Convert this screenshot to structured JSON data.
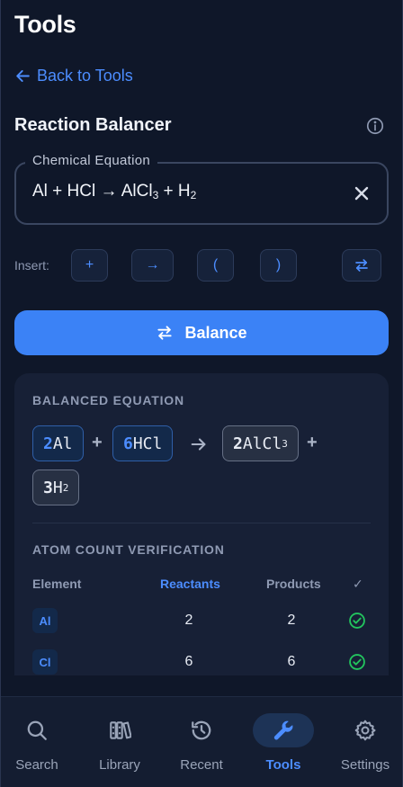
{
  "header": {
    "title": "Tools",
    "back_label": "Back to Tools"
  },
  "section": {
    "title": "Reaction Balancer"
  },
  "input": {
    "label": "Chemical Equation",
    "value_parts": [
      "Al + HCl → AlCl",
      "3",
      " + H",
      "2"
    ]
  },
  "insert": {
    "label": "Insert:",
    "buttons": [
      "+",
      "→",
      "(",
      ")"
    ]
  },
  "balance_button": {
    "label": "Balance"
  },
  "result": {
    "heading": "BALANCED EQUATION",
    "terms": [
      {
        "coef": "2",
        "formula": "Al",
        "sub": "",
        "side": "reactant"
      },
      {
        "coef": "6",
        "formula": "HCl",
        "sub": "",
        "side": "reactant"
      },
      {
        "coef": "2",
        "formula": "AlCl",
        "sub": "3",
        "side": "product"
      },
      {
        "coef": "3",
        "formula": "H",
        "sub": "2",
        "side": "product"
      }
    ],
    "plus": "+",
    "verification_heading": "ATOM COUNT VERIFICATION",
    "columns": [
      "Element",
      "Reactants",
      "Products",
      "✓"
    ],
    "rows": [
      {
        "element": "Al",
        "reactants": "2",
        "products": "2"
      },
      {
        "element": "Cl",
        "reactants": "6",
        "products": "6"
      }
    ]
  },
  "nav": {
    "items": [
      {
        "label": "Search",
        "icon": "search-icon"
      },
      {
        "label": "Library",
        "icon": "library-icon"
      },
      {
        "label": "Recent",
        "icon": "history-icon"
      },
      {
        "label": "Tools",
        "icon": "wrench-icon",
        "active": true
      },
      {
        "label": "Settings",
        "icon": "gear-icon"
      }
    ]
  },
  "colors": {
    "accent": "#3b82f6",
    "success": "#22c55e",
    "background": "#0f1729"
  }
}
